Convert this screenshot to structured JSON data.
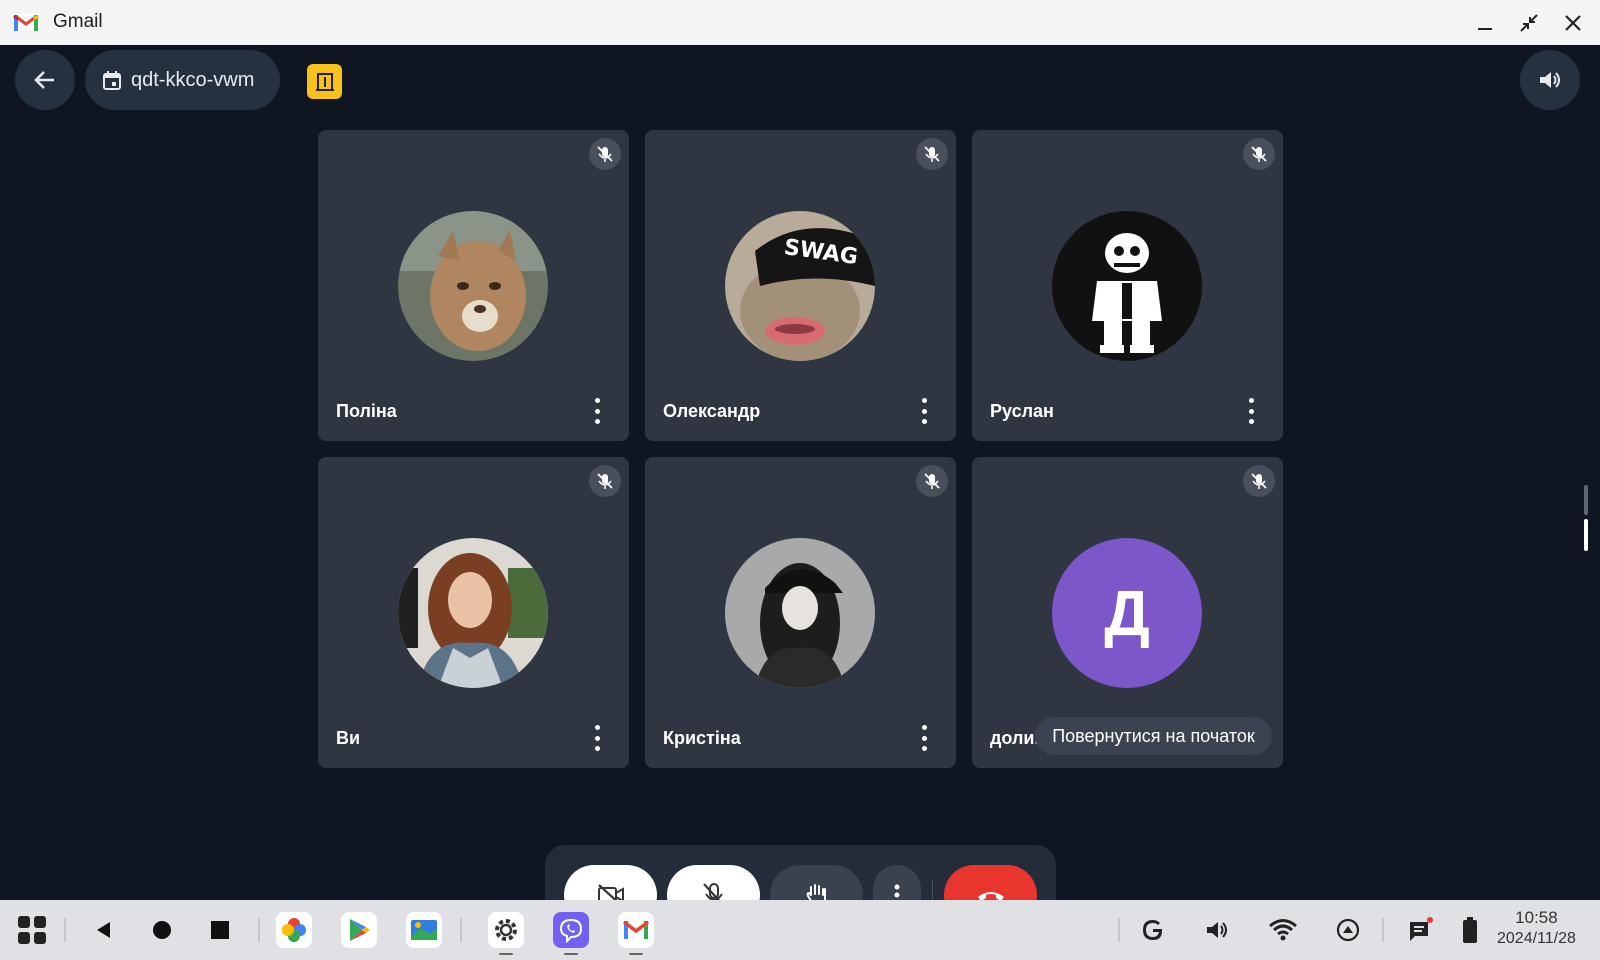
{
  "window": {
    "title": "Gmail"
  },
  "meeting": {
    "code": "qdt-kkco-vwm"
  },
  "participants": [
    {
      "name": "Поліна",
      "avatar": "photo-cougar"
    },
    {
      "name": "Олександр",
      "avatar": "photo-cat-swag-cap",
      "avatar_text": "SWAG"
    },
    {
      "name": "Руслан",
      "avatar": "drawing-skeleton"
    },
    {
      "name": "Ви",
      "avatar": "photo-woman"
    },
    {
      "name": "Кристіна",
      "avatar": "drawing-girl-cap"
    },
    {
      "name": "долине",
      "avatar_letter": "Д",
      "avatar_color": "#7b57c9"
    }
  ],
  "tooltip": {
    "text": "Повернутися на початок"
  },
  "controls": [
    {
      "name": "camera-off",
      "icon": "video-off-icon"
    },
    {
      "name": "mic-off",
      "icon": "mic-off-icon"
    },
    {
      "name": "raise-hand",
      "icon": "hand-icon"
    },
    {
      "name": "more-options",
      "icon": "more-vert-icon"
    },
    {
      "name": "end-call",
      "icon": "call-end-icon"
    }
  ],
  "taskbar": {
    "apps": [
      "Google Photos",
      "Google Play",
      "Files",
      "Settings",
      "Viber",
      "Gmail"
    ],
    "time": "10:58",
    "date": "2024/11/28"
  },
  "colors": {
    "background": "#0f1621",
    "tile": "#2f3642",
    "end_call": "#e8362f",
    "accent_yellow": "#f7c21c"
  }
}
